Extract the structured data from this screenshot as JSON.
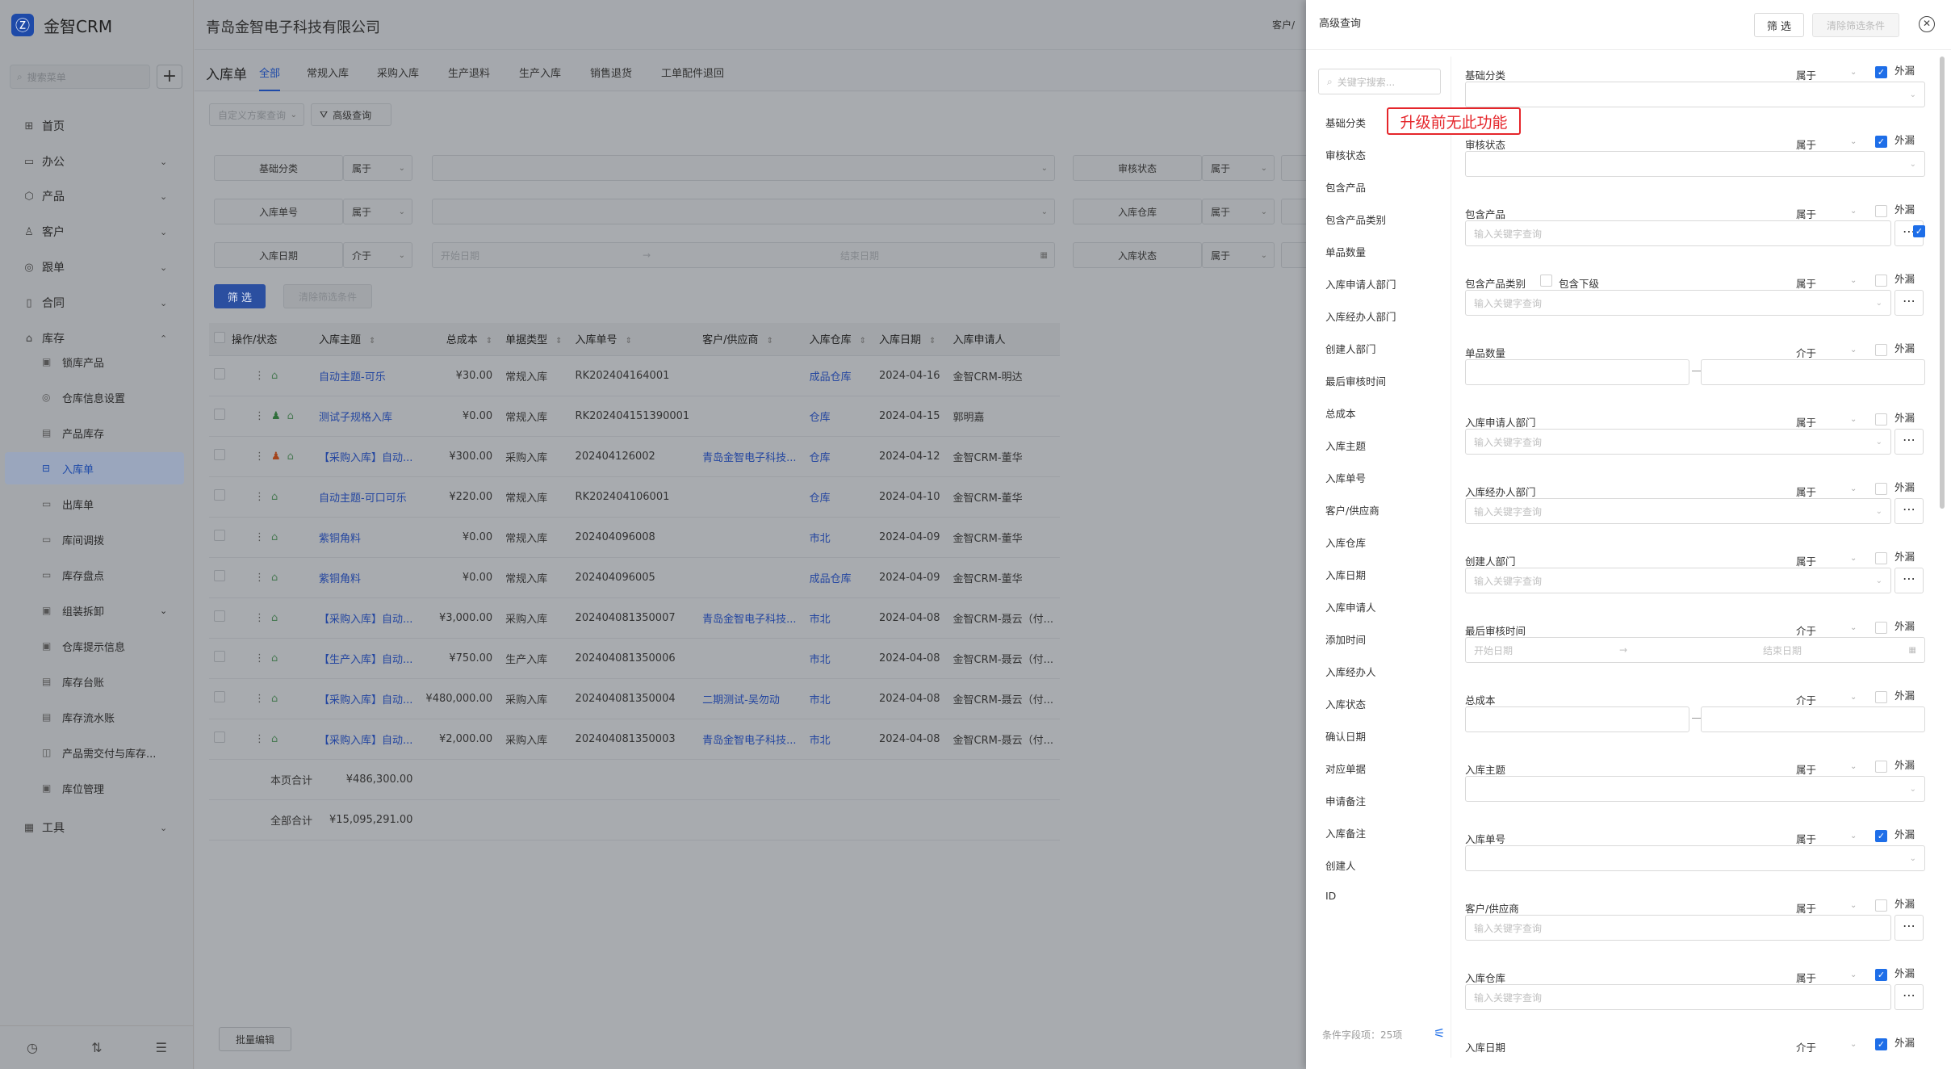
{
  "app": {
    "name": "金智CRM",
    "company": "青岛金智电子科技有限公司",
    "customer_prefix": "客户/"
  },
  "sidebar": {
    "search_placeholder": "搜索菜单",
    "items": [
      {
        "label": "首页",
        "icon": "home-icon",
        "glyph": "⊞"
      },
      {
        "label": "办公",
        "icon": "office-icon",
        "glyph": "▭"
      },
      {
        "label": "产品",
        "icon": "product-icon",
        "glyph": "⬡"
      },
      {
        "label": "客户",
        "icon": "customer-icon",
        "glyph": "♙"
      },
      {
        "label": "跟单",
        "icon": "follow-icon",
        "glyph": "◎"
      },
      {
        "label": "合同",
        "icon": "contract-icon",
        "glyph": "▯"
      },
      {
        "label": "库存",
        "icon": "inventory-icon",
        "glyph": "⌂"
      }
    ],
    "sub_items": [
      {
        "label": "锁库产品",
        "glyph": "▣"
      },
      {
        "label": "仓库信息设置",
        "glyph": "◎"
      },
      {
        "label": "产品库存",
        "glyph": "▤"
      },
      {
        "label": "入库单",
        "glyph": "⊟"
      },
      {
        "label": "出库单",
        "glyph": "▭"
      },
      {
        "label": "库间调拨",
        "glyph": "▭"
      },
      {
        "label": "库存盘点",
        "glyph": "▭"
      },
      {
        "label": "组装拆卸",
        "glyph": "▣"
      },
      {
        "label": "仓库提示信息",
        "glyph": "▣"
      },
      {
        "label": "库存台账",
        "glyph": "▤"
      },
      {
        "label": "库存流水账",
        "glyph": "▤"
      },
      {
        "label": "产品需交付与库存...",
        "glyph": "◫"
      },
      {
        "label": "库位管理",
        "glyph": "▣"
      }
    ],
    "tools": {
      "label": "工具",
      "glyph": "▦"
    }
  },
  "page": {
    "title": "入库单",
    "tabs": [
      "全部",
      "常规入库",
      "采购入库",
      "生产退料",
      "生产入库",
      "销售退货",
      "工单配件退回"
    ],
    "scheme_placeholder": "自定义方案查询",
    "adv_query": "高级查询",
    "filters": [
      {
        "label": "基础分类",
        "op": "属于",
        "label2": "审核状态",
        "op2": "属于"
      },
      {
        "label": "入库单号",
        "op": "属于",
        "label2": "入库仓库",
        "op2": "属于"
      },
      {
        "label": "入库日期",
        "op": "介于",
        "start": "开始日期",
        "end": "结束日期",
        "label2": "入库状态",
        "op2": "属于"
      }
    ],
    "filter_btn": "筛 选",
    "clear_btn": "清除筛选条件",
    "columns": [
      "操作/状态",
      "入库主题",
      "总成本",
      "单据类型",
      "入库单号",
      "客户/供应商",
      "入库仓库",
      "入库日期",
      "入库申请人"
    ],
    "rows": [
      {
        "subject": "自动主题-可乐",
        "cost": "¥30.00",
        "type": "常规入库",
        "no": "RK202404164001",
        "partner": "",
        "warehouse": "成品仓库",
        "date": "2024-04-16",
        "applicant": "金智CRM-明达"
      },
      {
        "subject": "测试子规格入库",
        "cost": "¥0.00",
        "type": "常规入库",
        "no": "RK202404151390001",
        "partner": "",
        "warehouse": "仓库",
        "date": "2024-04-15",
        "applicant": "郭明嘉"
      },
      {
        "subject": "【采购入库】自动...",
        "cost": "¥300.00",
        "type": "采购入库",
        "no": "202404126002",
        "partner": "青岛金智电子科技...",
        "warehouse": "仓库",
        "date": "2024-04-12",
        "applicant": "金智CRM-董华"
      },
      {
        "subject": "自动主题-可口可乐",
        "cost": "¥220.00",
        "type": "常规入库",
        "no": "RK202404106001",
        "partner": "",
        "warehouse": "仓库",
        "date": "2024-04-10",
        "applicant": "金智CRM-董华"
      },
      {
        "subject": "紫铜角料",
        "cost": "¥0.00",
        "type": "常规入库",
        "no": "202404096008",
        "partner": "",
        "warehouse": "市北",
        "date": "2024-04-09",
        "applicant": "金智CRM-董华"
      },
      {
        "subject": "紫铜角料",
        "cost": "¥0.00",
        "type": "常规入库",
        "no": "202404096005",
        "partner": "",
        "warehouse": "成品仓库",
        "date": "2024-04-09",
        "applicant": "金智CRM-董华"
      },
      {
        "subject": "【采购入库】自动...",
        "cost": "¥3,000.00",
        "type": "采购入库",
        "no": "202404081350007",
        "partner": "青岛金智电子科技...",
        "warehouse": "市北",
        "date": "2024-04-08",
        "applicant": "金智CRM-聂云（付..."
      },
      {
        "subject": "【生产入库】自动...",
        "cost": "¥750.00",
        "type": "生产入库",
        "no": "202404081350006",
        "partner": "",
        "warehouse": "市北",
        "date": "2024-04-08",
        "applicant": "金智CRM-聂云（付..."
      },
      {
        "subject": "【采购入库】自动...",
        "cost": "¥480,000.00",
        "type": "采购入库",
        "no": "202404081350004",
        "partner": "二期测试-吴勿动",
        "warehouse": "市北",
        "date": "2024-04-08",
        "applicant": "金智CRM-聂云（付..."
      },
      {
        "subject": "【采购入库】自动...",
        "cost": "¥2,000.00",
        "type": "采购入库",
        "no": "202404081350003",
        "partner": "青岛金智电子科技...",
        "warehouse": "市北",
        "date": "2024-04-08",
        "applicant": "金智CRM-聂云（付..."
      }
    ],
    "page_total_label": "本页合计",
    "page_total": "¥486,300.00",
    "all_total_label": "全部合计",
    "all_total": "¥15,095,291.00",
    "bulk_edit": "批量编辑"
  },
  "drawer": {
    "title": "高级查询",
    "filter_btn": "筛 选",
    "clear_btn": "清除筛选条件",
    "keyword_placeholder": "关键字搜索...",
    "fields": [
      "基础分类",
      "审核状态",
      "包含产品",
      "包含产品类别",
      "单品数量",
      "入库申请人部门",
      "入库经办人部门",
      "创建人部门",
      "最后审核时间",
      "总成本",
      "入库主题",
      "入库单号",
      "客户/供应商",
      "入库仓库",
      "入库日期",
      "入库申请人",
      "添加时间",
      "入库经办人",
      "入库状态",
      "确认日期",
      "对应单据",
      "申请备注",
      "入库备注",
      "创建人",
      "ID"
    ],
    "field_count": "条件字段项：25项",
    "badge": "升级前无此功能",
    "include_sub": "包含下级",
    "ext_label": "外漏",
    "input_placeholder": "输入关键字查询",
    "date_start": "开始日期",
    "date_end": "结束日期",
    "conditions": [
      {
        "label": "基础分类",
        "op": "属于",
        "checked": true
      },
      {
        "label": "审核状态",
        "op": "属于",
        "checked": true
      },
      {
        "label": "包含产品",
        "op": "属于",
        "checked": false
      },
      {
        "label": "包含产品类别",
        "op": "属于",
        "checked": false
      },
      {
        "label": "单品数量",
        "op": "介于",
        "checked": false
      },
      {
        "label": "入库申请人部门",
        "op": "属于",
        "checked": false
      },
      {
        "label": "入库经办人部门",
        "op": "属于",
        "checked": false
      },
      {
        "label": "创建人部门",
        "op": "属于",
        "checked": false
      },
      {
        "label": "最后审核时间",
        "op": "介于",
        "checked": false
      },
      {
        "label": "总成本",
        "op": "介于",
        "checked": false
      },
      {
        "label": "入库主题",
        "op": "属于",
        "checked": false
      },
      {
        "label": "入库单号",
        "op": "属于",
        "checked": true
      },
      {
        "label": "客户/供应商",
        "op": "属于",
        "checked": false
      },
      {
        "label": "入库仓库",
        "op": "属于",
        "checked": true
      },
      {
        "label": "入库日期",
        "op": "介于",
        "checked": true
      }
    ]
  }
}
